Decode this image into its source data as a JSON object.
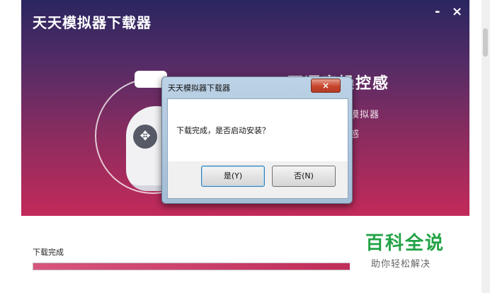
{
  "app": {
    "title": "天天模拟器下载器",
    "minimize_label": "-",
    "close_label": "×"
  },
  "promo": {
    "headline": "更逼真操控感",
    "lines": [
      "手柄模拟器",
      "操控感"
    ],
    "dpad_glyph": "✥"
  },
  "status": {
    "label": "下载完成",
    "progress": 1.0
  },
  "dialog": {
    "title": "天天模拟器下载器",
    "close_label": "×",
    "message": "下载完成，是否启动安装？",
    "yes_label": "是(Y)",
    "no_label": "否(N)"
  },
  "watermark": {
    "title": "百科全说",
    "subtitle": "助你轻松解决"
  },
  "colors": {
    "banner_top": "#2a2660",
    "banner_bottom": "#c22a5a",
    "progress_fill": "#b71f4c",
    "watermark_green": "#22a345"
  }
}
